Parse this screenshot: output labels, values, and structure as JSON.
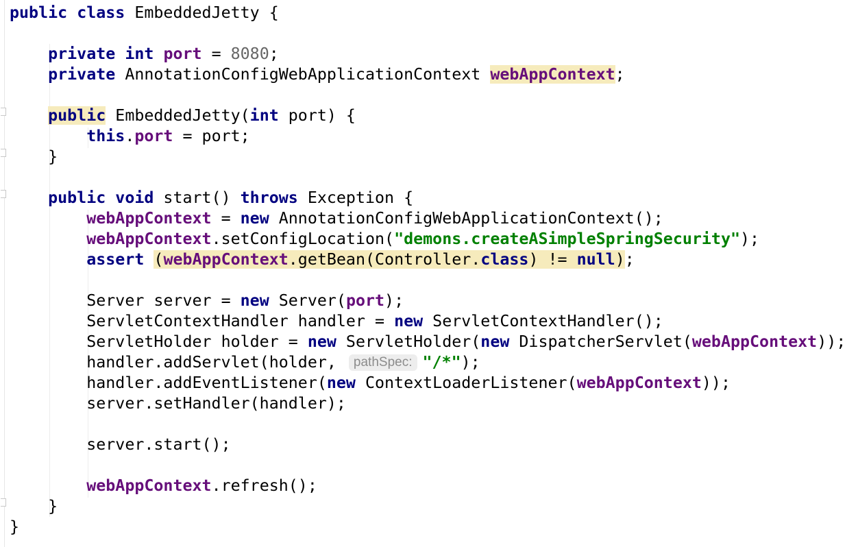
{
  "editor": {
    "language": "java",
    "colors": {
      "keyword": "#000080",
      "field": "#660e7a",
      "number": "#666666",
      "string": "#008000",
      "highlight": "#f6ebbc",
      "hint_bg": "#ededed",
      "hint_fg": "#8c8c8c"
    },
    "tokens": {
      "public": "public",
      "class": "class",
      "private": "private",
      "int": "int",
      "this": "this",
      "void": "void",
      "throws": "throws",
      "new": "new",
      "assert": "assert",
      "null": "null",
      "class_name": "EmbeddedJetty",
      "field_port": "port",
      "field_ctx": "webAppContext",
      "port_value": "8080",
      "ctx_type": "AnnotationConfigWebApplicationContext",
      "config_location": "\"demons.createASimpleSpringSecurity\"",
      "path_spec_hint": "pathSpec:",
      "path_spec_value": "\"/*\""
    },
    "text": {
      "l1_tail": " {",
      "l3_eq": " = ",
      "semi": ";",
      "space": " ",
      "ctor_open": "(",
      "ctor_param": " port) {",
      "dot": ".",
      "assign_port": " = port;",
      "close_brace": "}",
      "start_sig": " start() ",
      "exception": " Exception {",
      "ctx_new_tail": "();",
      "set_config": ".setConfigLocation(",
      "close_call": ");",
      "assert_open": "(",
      "get_bean": ".getBean(Controller.",
      "neq": ") != ",
      "paren_close": ")",
      "server_decl": "Server server = ",
      "server_new": " Server(",
      "handler_decl": "ServletContextHandler handler = ",
      "handler_new": " ServletContextHandler();",
      "holder_decl": "ServletHolder holder = ",
      "holder_new": " ServletHolder(",
      "dispatcher": " DispatcherServlet(",
      "double_close": "));",
      "add_servlet": "handler.addServlet(holder, ",
      "add_listener": "handler.addEventListener(",
      "loader": " ContextLoaderListener(",
      "set_handler": "server.setHandler(handler);",
      "server_start": "server.start();",
      "refresh": ".refresh();"
    }
  }
}
